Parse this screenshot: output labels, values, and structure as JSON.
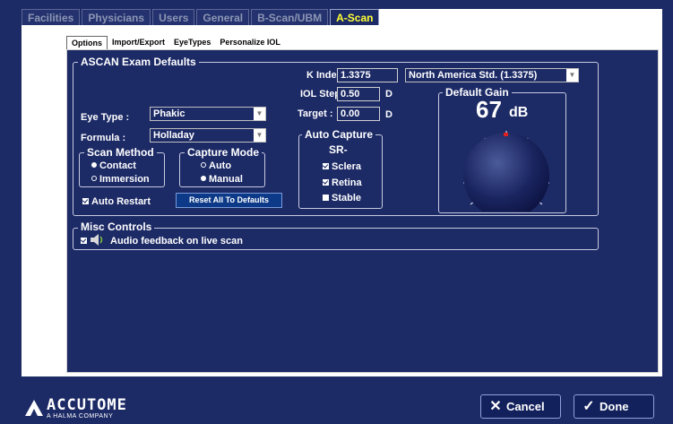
{
  "main_tabs": [
    "Facilities",
    "Physicians",
    "Users",
    "General",
    "B-Scan/UBM",
    "A-Scan"
  ],
  "active_main_tab": "A-Scan",
  "sub_tabs": [
    "Options",
    "Import/Export",
    "EyeTypes",
    "Personalize IOL"
  ],
  "active_sub_tab": "Options",
  "defaults": {
    "title": "ASCAN Exam Defaults",
    "k_index_label": "K Index :",
    "k_index_value": "1.3375",
    "k_index_std": "North America Std. (1.3375)",
    "iol_step_label": "IOL Step :",
    "iol_step_value": "0.50",
    "iol_step_unit": "D",
    "target_label": "Target :",
    "target_value": "0.00",
    "target_unit": "D",
    "eye_type_label": "Eye Type :",
    "eye_type_value": "Phakic",
    "formula_label": "Formula :",
    "formula_value": "Holladay",
    "scan_method_title": "Scan Method",
    "scan_methods": [
      {
        "label": "Contact",
        "selected": true
      },
      {
        "label": "Immersion",
        "selected": false
      }
    ],
    "capture_mode_title": "Capture Mode",
    "capture_modes": [
      {
        "label": "Auto",
        "selected": false
      },
      {
        "label": "Manual",
        "selected": true
      }
    ],
    "auto_restart_label": "Auto Restart",
    "auto_restart_checked": true,
    "reset_label": "Reset All To Defaults",
    "auto_capture_title": "Auto Capture",
    "auto_capture_mode": "SR-",
    "auto_capture_items": [
      {
        "label": "Sclera",
        "checked": true
      },
      {
        "label": "Retina",
        "checked": true
      },
      {
        "label": "Stable",
        "checked": false
      }
    ],
    "gain_title": "Default Gain",
    "gain_value": "67",
    "gain_unit": "dB"
  },
  "misc": {
    "title": "Misc Controls",
    "audio_label": "Audio feedback on live scan",
    "audio_checked": true
  },
  "footer": {
    "logo_text": "ACCUTOME",
    "logo_sub": "A HALMA COMPANY",
    "cancel_label": "Cancel",
    "done_label": "Done"
  },
  "icons": {
    "speaker": "speaker-icon",
    "cancel": "x-icon",
    "done": "check-icon",
    "logo": "accutome-logo-icon"
  },
  "colors": {
    "panel_bg": "#1c2a66",
    "active_tab_text": "#ffff33",
    "knob_indicator": "#e02020"
  }
}
